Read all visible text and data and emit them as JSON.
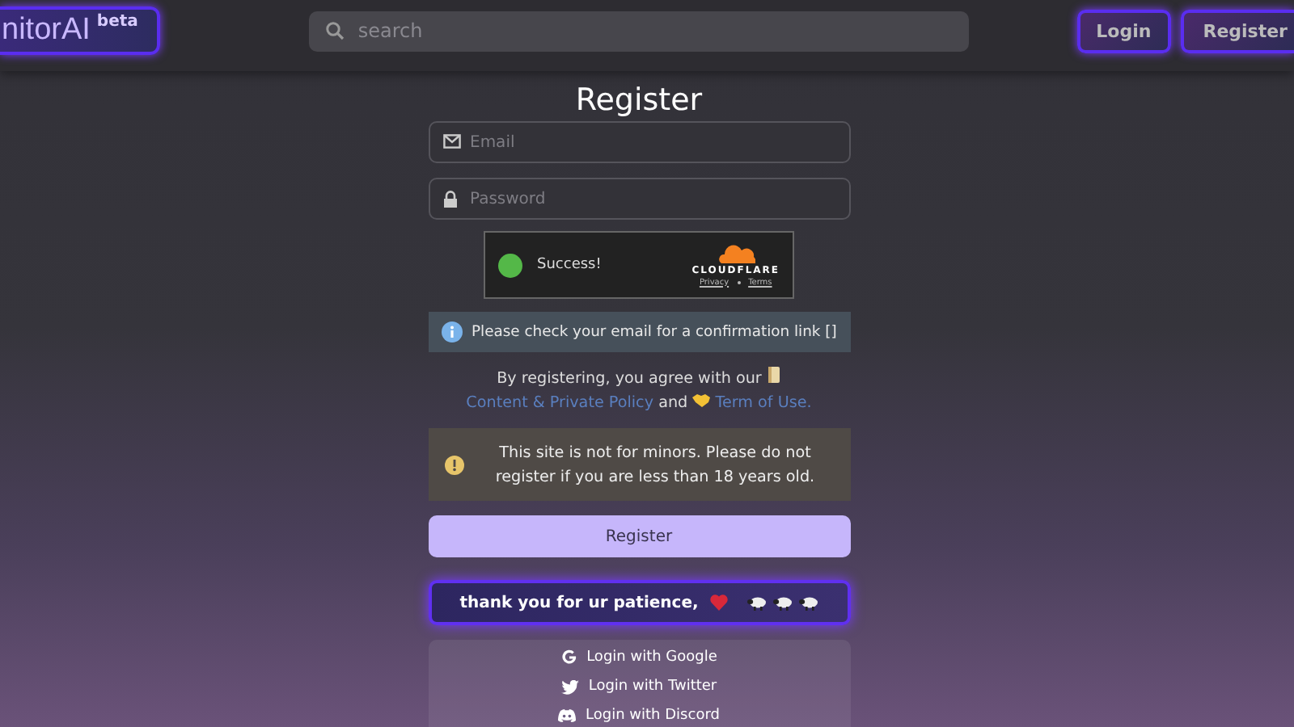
{
  "header": {
    "logo": "nitorAI",
    "badge": "beta",
    "search": {
      "placeholder": "search"
    },
    "buttons": [
      {
        "label": "Login"
      },
      {
        "label": "Register"
      }
    ]
  },
  "form": {
    "title": "Register",
    "fields": [
      {
        "kind": "email",
        "placeholder": "Email"
      },
      {
        "kind": "password",
        "placeholder": "Password"
      }
    ],
    "captcha": {
      "status": "Success!",
      "brand": "CLOUDFLARE",
      "links": [
        "Privacy",
        "Terms"
      ]
    },
    "info": "Please check your email for a confirmation link []",
    "agreement": {
      "lead": "By registering, you agree with our",
      "link1": "Content & Private Policy",
      "middle": "and",
      "link2": "Term of Use."
    },
    "warning": "This site is not for minors. Please do not register if you are less than 18 years old.",
    "submit": "Register",
    "banner": "thank you for ur patience,",
    "social": [
      {
        "kind": "google",
        "label": "Login with Google"
      },
      {
        "kind": "twitter",
        "label": "Login with Twitter"
      },
      {
        "kind": "discord",
        "label": "Login with Discord"
      }
    ]
  }
}
